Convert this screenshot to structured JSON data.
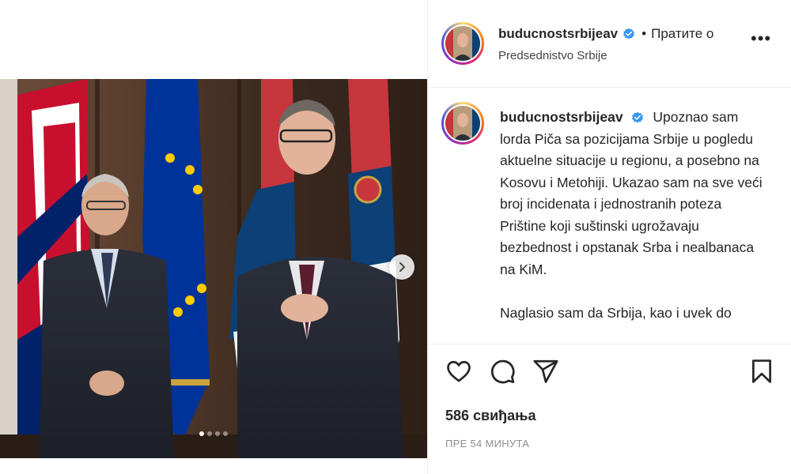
{
  "post": {
    "username": "buducnostsrbijeav",
    "follow_text": "Пратите о",
    "separator": "•",
    "location": "Predsednistvo Srbije",
    "more_label": "•••",
    "caption_paragraph_1": "Upoznao sam lorda Piča sa pozicijama Srbije u pogledu aktuelne situacije u regionu, a posebno na Kosovu i Metohiji. Ukazao sam na sve veći broj incidenata i jednostranih poteza Prištine koji suštinski ugrožavaju bezbednost i opstanak Srba i nealbanaca na KiM.",
    "caption_paragraph_2": "Naglasio sam da Srbija, kao i uvek do",
    "likes": "586 свиђања",
    "timestamp": "ПРЕ 54 МИНУТА"
  },
  "carousel": {
    "slide_count": 4,
    "active_slide": 1
  },
  "icons": {
    "verified": "verified-badge-icon",
    "like": "heart-icon",
    "comment": "comment-icon",
    "share": "paper-plane-icon",
    "save": "bookmark-icon",
    "next": "chevron-right-icon"
  },
  "colors": {
    "verified_blue": "#3897f0",
    "text": "#262626",
    "muted": "#8e8e8e"
  }
}
